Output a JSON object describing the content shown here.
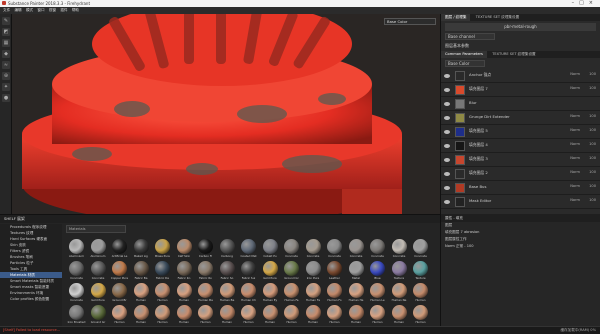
{
  "window": {
    "title": "Substance Painter 2018.3.3 - Firehydrant"
  },
  "menu": [
    "文件",
    "编辑",
    "模式",
    "窗口",
    "视窗",
    "插件",
    "帮助"
  ],
  "viewport": {
    "view_mode": "Base Color"
  },
  "layers_panel": {
    "tabs": [
      "图层 / 纹理集",
      "TEXTURE SET 纹理集设置"
    ],
    "top_button": "pbr-metal-rough",
    "channel": "Base channel",
    "section": "图层基本参数",
    "sub_tabs": [
      "Common Parameters",
      "TEXTURE SET 纹理集设置"
    ],
    "blend": "Base Color",
    "rows": [
      {
        "name": "Anchor 锚点",
        "mode": "Norm",
        "opacity": "100"
      },
      {
        "name": "填充图层 7",
        "mode": "Norm",
        "opacity": "100"
      },
      {
        "name": "Blur",
        "mode": "",
        "opacity": ""
      },
      {
        "name": "Grunge Dirt Extender",
        "mode": "Norm",
        "opacity": "100"
      },
      {
        "name": "填充图层 5",
        "mode": "Norm",
        "opacity": "100"
      },
      {
        "name": "填充图层 4",
        "mode": "Norm",
        "opacity": "100"
      },
      {
        "name": "填充图层 3",
        "mode": "Norm",
        "opacity": "100"
      },
      {
        "name": "填充图层 2",
        "mode": "Norm",
        "opacity": "100"
      },
      {
        "name": "Base Bus",
        "mode": "Norm",
        "opacity": "100"
      },
      {
        "name": "Mask Editor",
        "mode": "Norm",
        "opacity": "100"
      }
    ],
    "colors": {
      "row_thumbs": [
        "#2a2a2a",
        "#d94a2c",
        "#777777",
        "#8f8a45",
        "#1e2e8a",
        "#161616",
        "#c7462e",
        "#2a2a2a",
        "#b13a24",
        "#222222"
      ]
    }
  },
  "shelf": {
    "title": "SHELF 展架",
    "search_placeholder": "Materials",
    "categories": [
      "Procedurals 程序纹理",
      "Textures 纹理",
      "Hard Surfaces 硬表面",
      "Skin 皮肤",
      "Filters 滤镜",
      "Brushes 笔刷",
      "Particles 粒子",
      "Tools 工具",
      "Materials 材质",
      "Smart Materials 智能材质",
      "Smart masks 智能遮罩",
      "Environments 环境",
      "Color profiles 颜色配置"
    ],
    "selected_category": "Materials 材质",
    "materials": [
      {
        "label": "Aluminium",
        "color": "#b8b8b8"
      },
      {
        "label": "Aluminium",
        "color": "#9e9e9e"
      },
      {
        "label": "Artificial Le",
        "color": "#222222"
      },
      {
        "label": "Baked Lig",
        "color": "#3b3b3b"
      },
      {
        "label": "Brass Pure",
        "color": "#c8a248"
      },
      {
        "label": "Calf Skin",
        "color": "#b88a6a"
      },
      {
        "label": "Carbon Fi",
        "color": "#1a1a1a"
      },
      {
        "label": "Carbong",
        "color": "#555555"
      },
      {
        "label": "Coated Met",
        "color": "#606a78"
      },
      {
        "label": "Cobalt Pu",
        "color": "#7e8088"
      },
      {
        "label": "Concrete",
        "color": "#8a8580"
      },
      {
        "label": "Concrete",
        "color": "#a49a8e"
      },
      {
        "label": "Concrete",
        "color": "#8a8a8a"
      },
      {
        "label": "Concrete",
        "color": "#9a9490"
      },
      {
        "label": "Concrete",
        "color": "#7d7a77"
      },
      {
        "label": "Concrete",
        "color": "#c2bcb4"
      },
      {
        "label": "Concrete",
        "color": "#a0a0a0"
      },
      {
        "label": "Concrete",
        "color": "#6e6e6e"
      },
      {
        "label": "Concrete",
        "color": "#5a5a5a"
      },
      {
        "label": "Copper Pure",
        "color": "#c07a4a"
      },
      {
        "label": "Fabric Ba",
        "color": "#6a5a4a"
      },
      {
        "label": "Fabric De",
        "color": "#3a4a5a"
      },
      {
        "label": "Fabric Kn",
        "color": "#7a6a5a"
      },
      {
        "label": "Fabric Ro",
        "color": "#8a7a6a"
      },
      {
        "label": "Fabric So",
        "color": "#5a5050"
      },
      {
        "label": "Fabric Sui",
        "color": "#404040"
      },
      {
        "label": "Gold Pure",
        "color": "#d4a848"
      },
      {
        "label": "Ground Gr",
        "color": "#6a7a4a"
      },
      {
        "label": "Iron Pure",
        "color": "#8c8c8c"
      },
      {
        "label": "Leather",
        "color": "#7a4a30"
      },
      {
        "label": "Metal",
        "color": "#9e9e9e"
      },
      {
        "label": "Blue",
        "color": "#3a4ac0"
      },
      {
        "label": "Texture",
        "color": "#8a7aa0"
      },
      {
        "label": "Texture",
        "color": "#5aa0a0"
      },
      {
        "label": "Concrete",
        "color": "#d0d0d0"
      },
      {
        "label": "Gold Pure",
        "color": "#d4a848"
      },
      {
        "label": "Ground Br",
        "color": "#8a6a4a"
      },
      {
        "label": "Human",
        "color": "#d8a080"
      },
      {
        "label": "Human",
        "color": "#c89070"
      },
      {
        "label": "Human",
        "color": "#d8a080"
      },
      {
        "label": "Human Ba",
        "color": "#c89070"
      },
      {
        "label": "Human Ba",
        "color": "#d09a78"
      },
      {
        "label": "Human Ch",
        "color": "#c88c6c"
      },
      {
        "label": "Human Ey",
        "color": "#d49a7a"
      },
      {
        "label": "Human Fa",
        "color": "#c8906e"
      },
      {
        "label": "Human Fe",
        "color": "#d4a080"
      },
      {
        "label": "Human Fo",
        "color": "#c48a6a"
      },
      {
        "label": "Human He",
        "color": "#d8a282"
      },
      {
        "label": "Human Le",
        "color": "#c89070"
      },
      {
        "label": "Human Ne",
        "color": "#d09a78"
      },
      {
        "label": "Human",
        "color": "#c48a6a"
      },
      {
        "label": "Iron Brushed",
        "color": "#7a7a7a"
      },
      {
        "label": "Ground Gr",
        "color": "#5a6a3a"
      },
      {
        "label": "Human",
        "color": "#d8a080"
      },
      {
        "label": "Human",
        "color": "#c89070"
      },
      {
        "label": "Human",
        "color": "#d09a78"
      },
      {
        "label": "Human",
        "color": "#c88c6c"
      },
      {
        "label": "Human",
        "color": "#d4a080"
      },
      {
        "label": "Human",
        "color": "#c48a6a"
      },
      {
        "label": "Human",
        "color": "#d8a282"
      },
      {
        "label": "Human",
        "color": "#c89070"
      },
      {
        "label": "Human",
        "color": "#d09a78"
      },
      {
        "label": "Human",
        "color": "#c88c6c"
      },
      {
        "label": "Human",
        "color": "#d4a080"
      },
      {
        "label": "Human",
        "color": "#c48a6a"
      },
      {
        "label": "Human",
        "color": "#d8a282"
      },
      {
        "label": "Human",
        "color": "#c89070"
      },
      {
        "label": "Human",
        "color": "#d09a78"
      }
    ]
  },
  "properties": {
    "title": "属性 - 填充",
    "section": "图层",
    "field": "填充图层 7 abrasion",
    "line2": "图层属性工作",
    "mode_label": "Norm 正常 - 100"
  },
  "status": {
    "error": "[Shelf] Failed to load resource...",
    "right": "缓存加载中(RAM) 0%"
  }
}
